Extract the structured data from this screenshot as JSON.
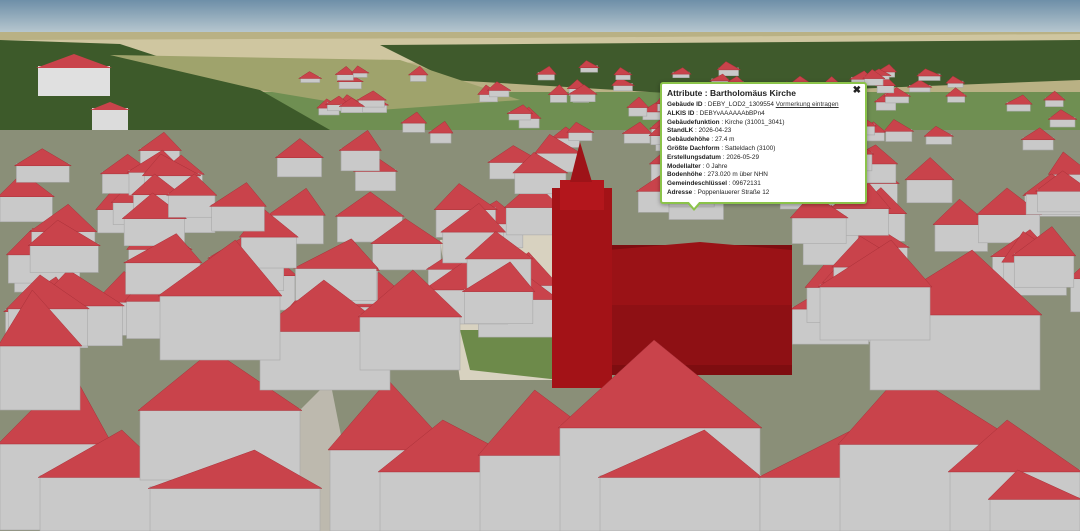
{
  "popup": {
    "title": "Attribute : Bartholomäus Kirche",
    "close_label": "✖",
    "link_label": "Vormerkung eintragen",
    "rows": [
      {
        "key": "Gebäude ID",
        "value": "DEBY_LOD2_1309554"
      },
      {
        "key": "ALKIS ID",
        "value": "DEBYvAAAAAAbBPn4"
      },
      {
        "key": "Gebäudefunktion",
        "value": "Kirche (31001_3041)"
      },
      {
        "key": "StandLK",
        "value": "2026-04-23"
      },
      {
        "key": "Gebäudehöhe",
        "value": "27.4 m"
      },
      {
        "key": "Größte Dachform",
        "value": "Satteldach (3100)"
      },
      {
        "key": "Erstellungsdatum",
        "value": "2026-05-29"
      },
      {
        "key": "Modellalter",
        "value": "0 Jahre"
      },
      {
        "key": "Bodenhöhe",
        "value": "273.020 m über NHN"
      },
      {
        "key": "Gemeindeschlüssel",
        "value": "09672131"
      },
      {
        "key": "Adresse",
        "value": "Poppenlauerer Straße 12"
      }
    ]
  },
  "colors": {
    "roof": "#c9434b",
    "wall": "#c9c9c9",
    "highlight": "#b5141a",
    "popup_border": "#8bc34a"
  }
}
